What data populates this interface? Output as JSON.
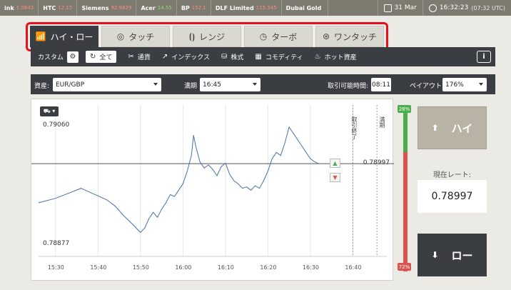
{
  "ticker": {
    "items": [
      {
        "name": "ink",
        "value": "1.0843",
        "trend": "neg"
      },
      {
        "name": "HTC",
        "value": "12.15",
        "trend": "neg"
      },
      {
        "name": "Siemens",
        "value": "92.9829",
        "trend": "neg"
      },
      {
        "name": "Acer",
        "value": "14.55",
        "trend": "pos"
      },
      {
        "name": "BP",
        "value": "152.1",
        "trend": "neg"
      },
      {
        "name": "DLF Limited",
        "value": "115.345",
        "trend": "neg"
      },
      {
        "name": "Dubai Gold",
        "value": "",
        "trend": ""
      }
    ],
    "date": "31 Mar",
    "time": "16:32:23",
    "utc": "(07:32 UTC)"
  },
  "tabs": [
    {
      "label": "ハイ・ロー",
      "icon": "chart-up-icon",
      "glyph": "📶",
      "active": true
    },
    {
      "label": "タッチ",
      "icon": "target-icon",
      "glyph": "◎",
      "active": false
    },
    {
      "label": "レンジ",
      "icon": "range-icon",
      "glyph": "⦗⦘",
      "active": false
    },
    {
      "label": "ターボ",
      "icon": "clock-icon",
      "glyph": "◷",
      "active": false
    },
    {
      "label": "ワンタッチ",
      "icon": "onetouch-icon",
      "glyph": "⊛",
      "active": false
    }
  ],
  "categories": {
    "custom_label": "カスタム",
    "items": [
      {
        "label": "全て",
        "glyph": "↻",
        "icon": "refresh-icon",
        "selected": true
      },
      {
        "label": "通貨",
        "glyph": "✂",
        "icon": "currency-icon",
        "selected": false
      },
      {
        "label": "インデックス",
        "glyph": "↗",
        "icon": "index-icon",
        "selected": false
      },
      {
        "label": "株式",
        "glyph": "⛁",
        "icon": "stock-icon",
        "selected": false
      },
      {
        "label": "コモディティ",
        "glyph": "▦",
        "icon": "commodity-icon",
        "selected": false
      },
      {
        "label": "ホット資産",
        "glyph": "♨",
        "icon": "flame-icon",
        "selected": false
      }
    ],
    "info": "i"
  },
  "controls": {
    "asset_label": "資産:",
    "asset_value": "EUR/GBP",
    "expiry_label": "満期",
    "expiry_value": "16:45",
    "remaining_label": "取引可能時間:",
    "remaining_value": "08:11",
    "payout_label": "ペイアウト:",
    "payout_value": "176%"
  },
  "chart_data": {
    "type": "line",
    "title": "",
    "xlabel": "",
    "ylabel": "",
    "x_ticks": [
      "15:30",
      "15:40",
      "15:50",
      "16:00",
      "16:10",
      "16:20",
      "16:30",
      "16:40"
    ],
    "y_ticks": [
      "0.79060",
      "0.78877"
    ],
    "xlim_minutes": [
      15.45,
      16.5
    ],
    "ylim": [
      0.7885,
      0.7909
    ],
    "current_price": "0.78997",
    "current_value": 0.78997,
    "markers": [
      {
        "label": "取引終了",
        "time": "16:40"
      },
      {
        "label": "満期",
        "time": "16:45"
      }
    ],
    "series": [
      {
        "x_minutes": [
          1526,
          1530,
          1533,
          1536,
          1538,
          1540,
          1542,
          1544,
          1546,
          1548,
          1550,
          1551,
          1552,
          1553,
          1554,
          1555,
          1556,
          1557,
          1558,
          1600,
          1601,
          1602,
          1602.5,
          1603,
          1604,
          1605,
          1606,
          1607,
          1608,
          1609,
          1610,
          1611,
          1612,
          1613,
          1614,
          1615,
          1616,
          1617,
          1618,
          1619,
          1620,
          1621,
          1622,
          1623,
          1624,
          1625,
          1626,
          1627,
          1628,
          1629,
          1630,
          1631,
          1632
        ],
        "y": [
          0.78935,
          0.78942,
          0.7895,
          0.78958,
          0.78952,
          0.78946,
          0.7894,
          0.7893,
          0.78915,
          0.78902,
          0.78888,
          0.78895,
          0.7891,
          0.7892,
          0.78912,
          0.78925,
          0.78935,
          0.78948,
          0.78945,
          0.78965,
          0.78985,
          0.7901,
          0.79042,
          0.79025,
          0.79,
          0.7899,
          0.78995,
          0.78988,
          0.78978,
          0.78992,
          0.78998,
          0.7898,
          0.7897,
          0.78965,
          0.78958,
          0.7896,
          0.78955,
          0.78962,
          0.78958,
          0.7897,
          0.78985,
          0.79005,
          0.79015,
          0.7901,
          0.7903,
          0.79055,
          0.79045,
          0.79035,
          0.79025,
          0.79015,
          0.79005,
          0.79,
          0.78997
        ]
      }
    ]
  },
  "meter": {
    "hi_pct": "28%",
    "lo_pct": "72%",
    "hi_fraction": 0.28,
    "hi_color": "#4cae4c",
    "lo_color": "#d9534f"
  },
  "trade": {
    "hi_label": "ハイ",
    "lo_label": "ロー",
    "rate_label": "現在レート:",
    "rate_value": "0.78997"
  }
}
